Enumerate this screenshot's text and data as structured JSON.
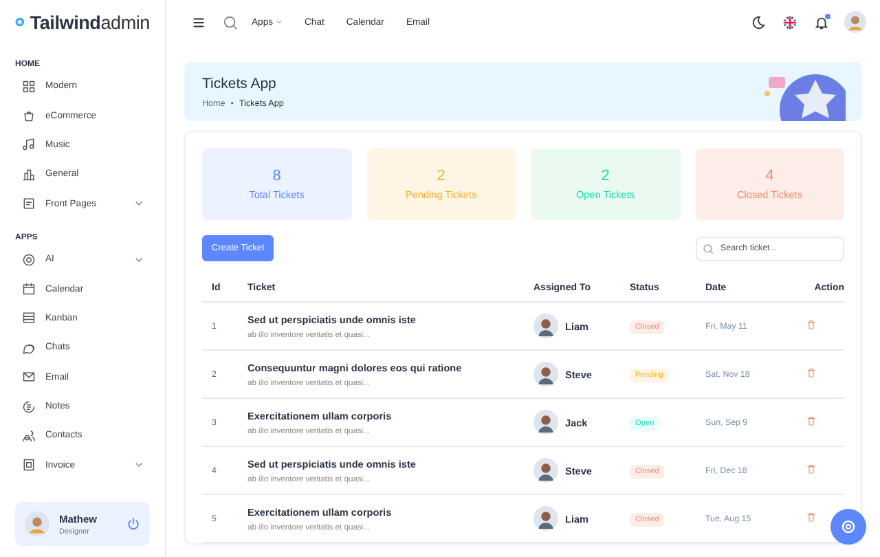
{
  "logo": {
    "brand": "Tailwind",
    "suffix": "admin"
  },
  "sidebar": {
    "sections": [
      {
        "heading": "HOME",
        "items": [
          {
            "label": "Modern",
            "kind": "link"
          },
          {
            "label": "eCommerce",
            "kind": "link"
          },
          {
            "label": "Music",
            "kind": "link"
          },
          {
            "label": "General",
            "kind": "link"
          },
          {
            "label": "Front Pages",
            "kind": "group"
          }
        ]
      },
      {
        "heading": "APPS",
        "items": [
          {
            "label": "AI",
            "kind": "group"
          },
          {
            "label": "Calendar",
            "kind": "link"
          },
          {
            "label": "Kanban",
            "kind": "link"
          },
          {
            "label": "Chats",
            "kind": "link"
          },
          {
            "label": "Email",
            "kind": "link"
          },
          {
            "label": "Notes",
            "kind": "link"
          },
          {
            "label": "Contacts",
            "kind": "link"
          },
          {
            "label": "Invoice",
            "kind": "group"
          }
        ]
      }
    ],
    "profile": {
      "name": "Mathew",
      "role": "Designer"
    }
  },
  "topbar": {
    "links": [
      {
        "label": "Apps",
        "kind": "menu"
      },
      {
        "label": "Chat",
        "kind": "link"
      },
      {
        "label": "Calendar",
        "kind": "link"
      },
      {
        "label": "Email",
        "kind": "link"
      }
    ],
    "notification_dot": true
  },
  "banner": {
    "title": "Tickets App",
    "breadcrumb": [
      "Home",
      "Tickets App"
    ],
    "separator": "•"
  },
  "stats": [
    {
      "count": "8",
      "label": "Total Tickets",
      "kind": "primary"
    },
    {
      "count": "2",
      "label": "Pending Tickets",
      "kind": "warning"
    },
    {
      "count": "2",
      "label": "Open Tickets",
      "kind": "success"
    },
    {
      "count": "4",
      "label": "Closed Tickets",
      "kind": "error"
    }
  ],
  "create_button": "Create Ticket",
  "search": {
    "placeholder": "Search ticket..."
  },
  "table": {
    "columns": [
      "Id",
      "Ticket",
      "Assigned To",
      "Status",
      "Date",
      "Action"
    ],
    "rows": [
      {
        "id": "1",
        "title": "Sed ut perspiciatis unde omnis iste",
        "subtitle": "ab illo inventore veritatis et quasi...",
        "assignee": "Liam",
        "status": "Closed",
        "kind": "closed",
        "date": "Fri, May 11"
      },
      {
        "id": "2",
        "title": "Consequuntur magni dolores eos qui ratione",
        "subtitle": "ab illo inventore veritatis et quasi...",
        "assignee": "Steve",
        "status": "Pending",
        "kind": "pending",
        "date": "Sat, Nov 18"
      },
      {
        "id": "3",
        "title": "Exercitationem ullam corporis",
        "subtitle": "ab illo inventore veritatis et quasi...",
        "assignee": "Jack",
        "status": "Open",
        "kind": "open",
        "date": "Sun, Sep 9"
      },
      {
        "id": "4",
        "title": "Sed ut perspiciatis unde omnis iste",
        "subtitle": "ab illo inventore veritatis et quasi...",
        "assignee": "Steve",
        "status": "Closed",
        "kind": "closed",
        "date": "Fri, Dec 18"
      },
      {
        "id": "5",
        "title": "Exercitationem ullam corporis",
        "subtitle": "ab illo inventore veritatis et quasi...",
        "assignee": "Liam",
        "status": "Closed",
        "kind": "closed",
        "date": "Tue, Aug 15"
      }
    ]
  }
}
